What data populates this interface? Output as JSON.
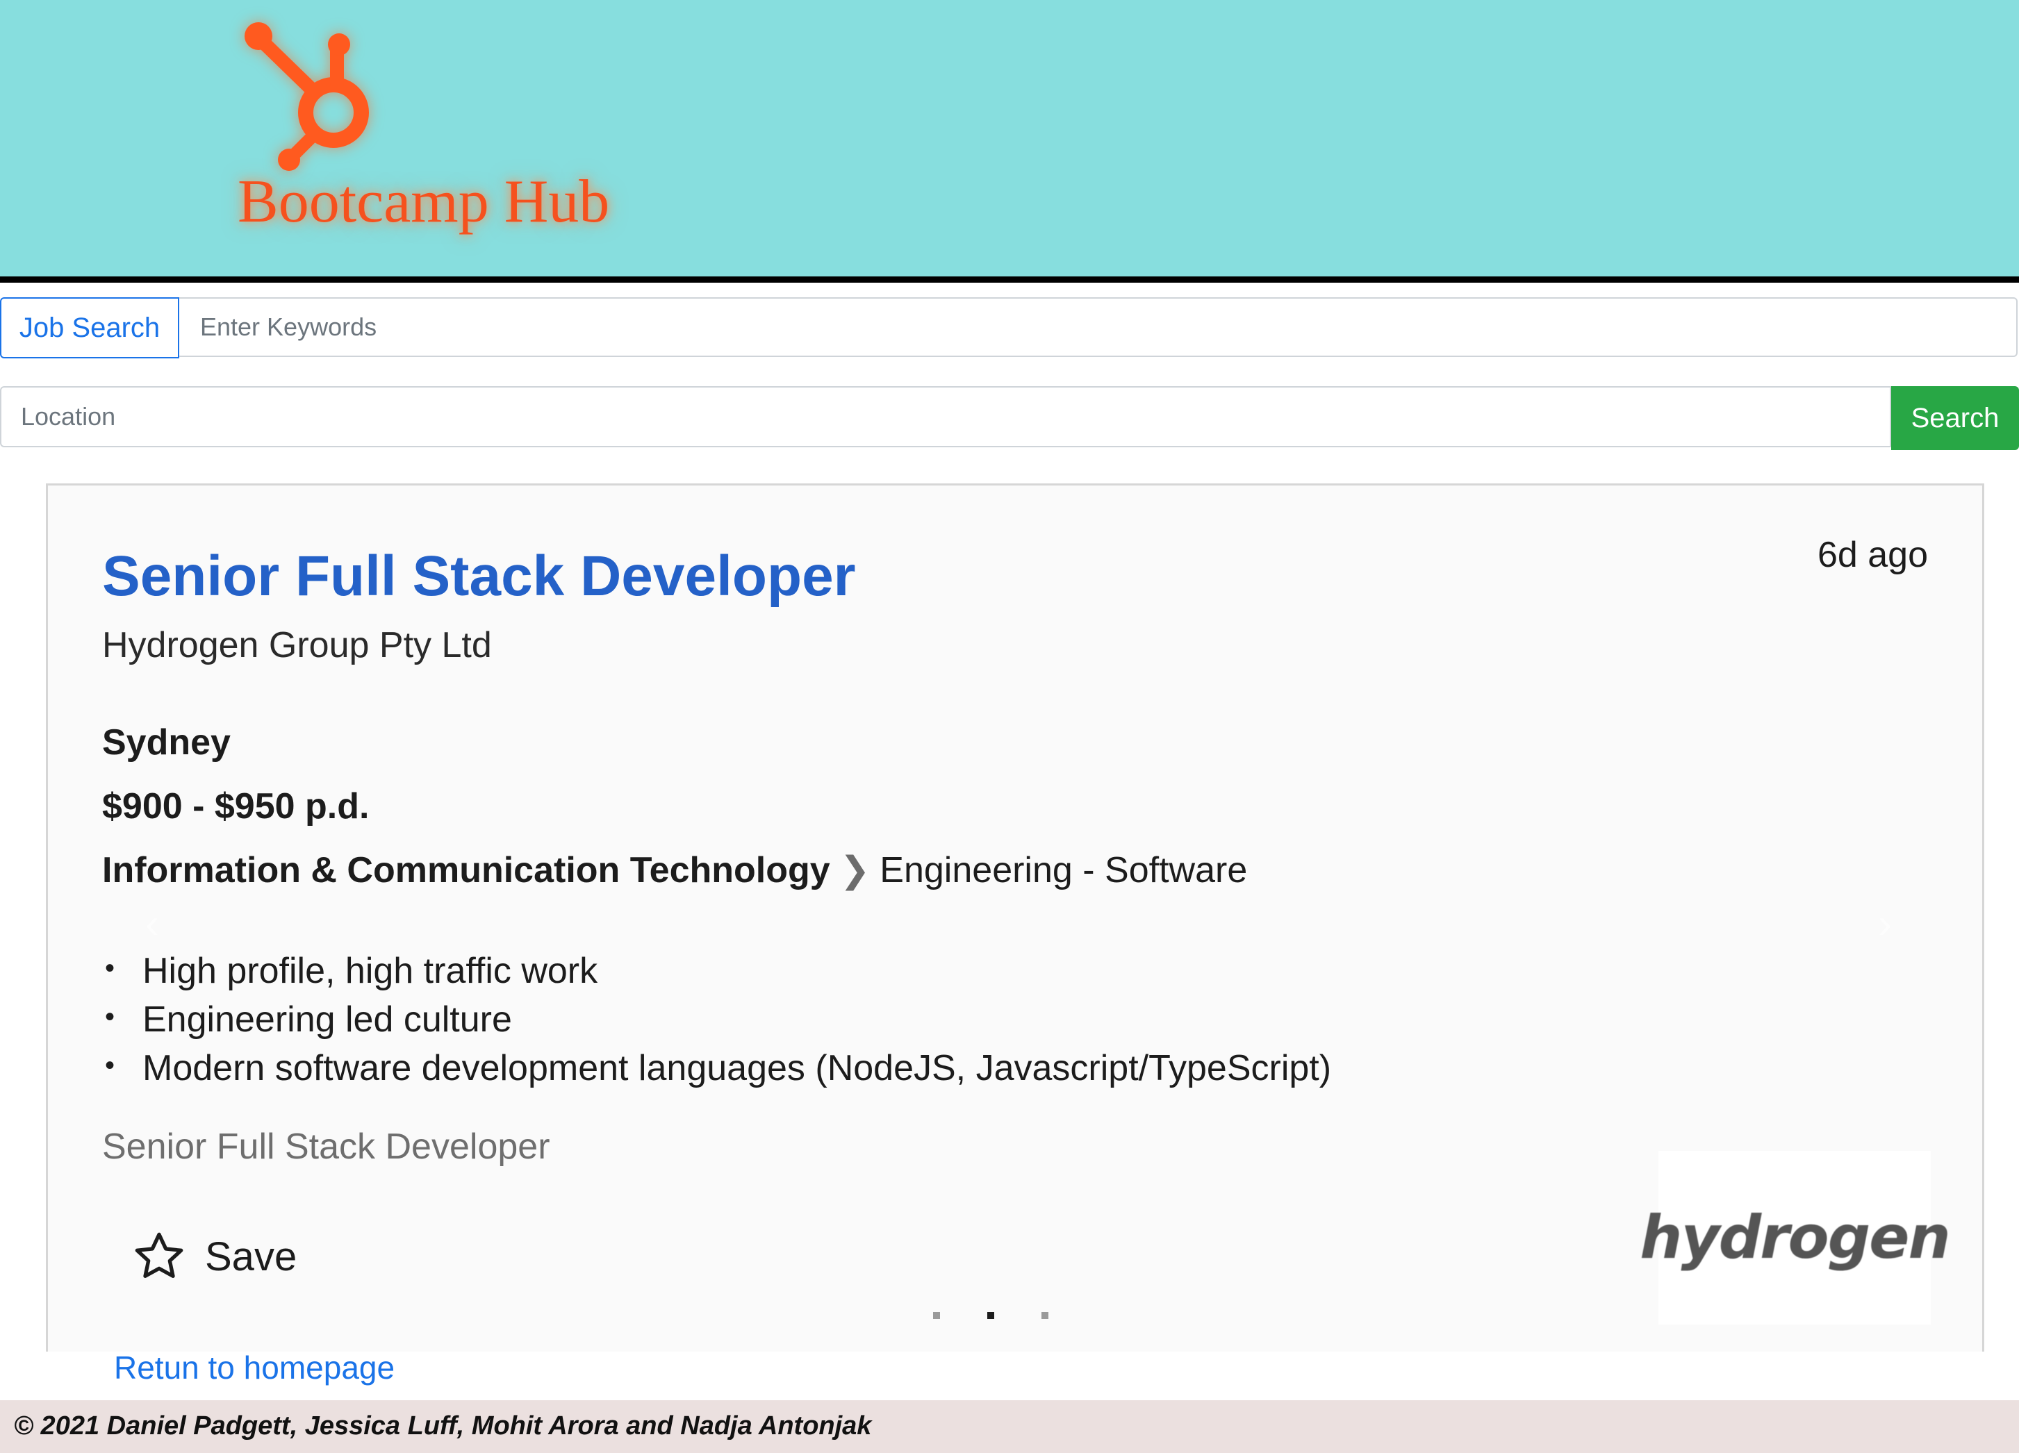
{
  "header": {
    "brand_name": "Bootcamp Hub",
    "brand_color": "#f5511e",
    "background_color": "#87dede",
    "logo_icon": "hubspot-sprocket-icon"
  },
  "search": {
    "job_search_label": "Job Search",
    "keywords_placeholder": "Enter Keywords",
    "keywords_value": "",
    "location_placeholder": "Location",
    "location_value": "",
    "search_label": "Search",
    "search_button_color": "#28a745"
  },
  "job_card": {
    "title": "Senior Full Stack Developer",
    "posted": "6d ago",
    "company": "Hydrogen Group Pty Ltd",
    "location": "Sydney",
    "salary": "$900 - $950 p.d.",
    "classification": "Information & Communication Technology",
    "sub_classification": "Engineering - Software",
    "separator_icon": "chevron-right-icon",
    "bullets": [
      "High profile, high traffic work",
      "Engineering led culture",
      "Modern software development languages (NodeJS, Javascript/TypeScript)"
    ],
    "teaser": "Senior Full Stack Developer",
    "save_label": "Save",
    "save_icon": "star-outline-icon",
    "company_logo_text": "hydrogen",
    "title_color": "#2461c8"
  },
  "carousel": {
    "indicator_count": 3,
    "active_index": 1
  },
  "links": {
    "return_homepage": "Retun to homepage"
  },
  "footer": {
    "copyright": "© 2021 Daniel Padgett, Jessica Luff, Mohit Arora and Nadja Antonjak"
  }
}
